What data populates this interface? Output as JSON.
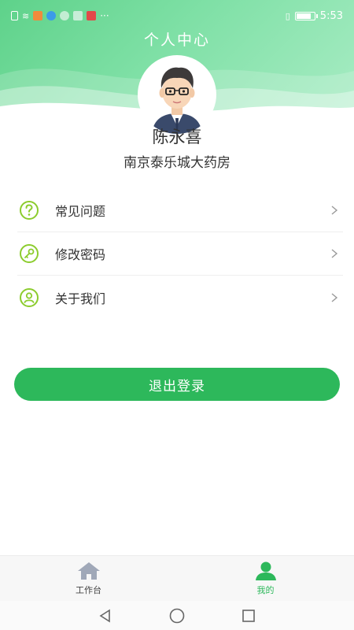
{
  "status_bar": {
    "time": "5:53",
    "battery_level": 0.85,
    "more": "···"
  },
  "header": {
    "title": "个人中心"
  },
  "profile": {
    "name": "陈永喜",
    "organization": "南京泰乐城大药房"
  },
  "menu": [
    {
      "label": "常见问题",
      "icon": "question-icon"
    },
    {
      "label": "修改密码",
      "icon": "key-icon"
    },
    {
      "label": "关于我们",
      "icon": "person-icon"
    }
  ],
  "logout": {
    "label": "退出登录"
  },
  "tabbar": [
    {
      "label": "工作台",
      "icon": "home-icon",
      "active": false
    },
    {
      "label": "我的",
      "icon": "user-icon",
      "active": true
    }
  ],
  "colors": {
    "accent": "#2db85b",
    "icon_green": "#8ccc2e",
    "header_green": "#5ed28a",
    "inactive_icon": "#a0a8b8"
  }
}
